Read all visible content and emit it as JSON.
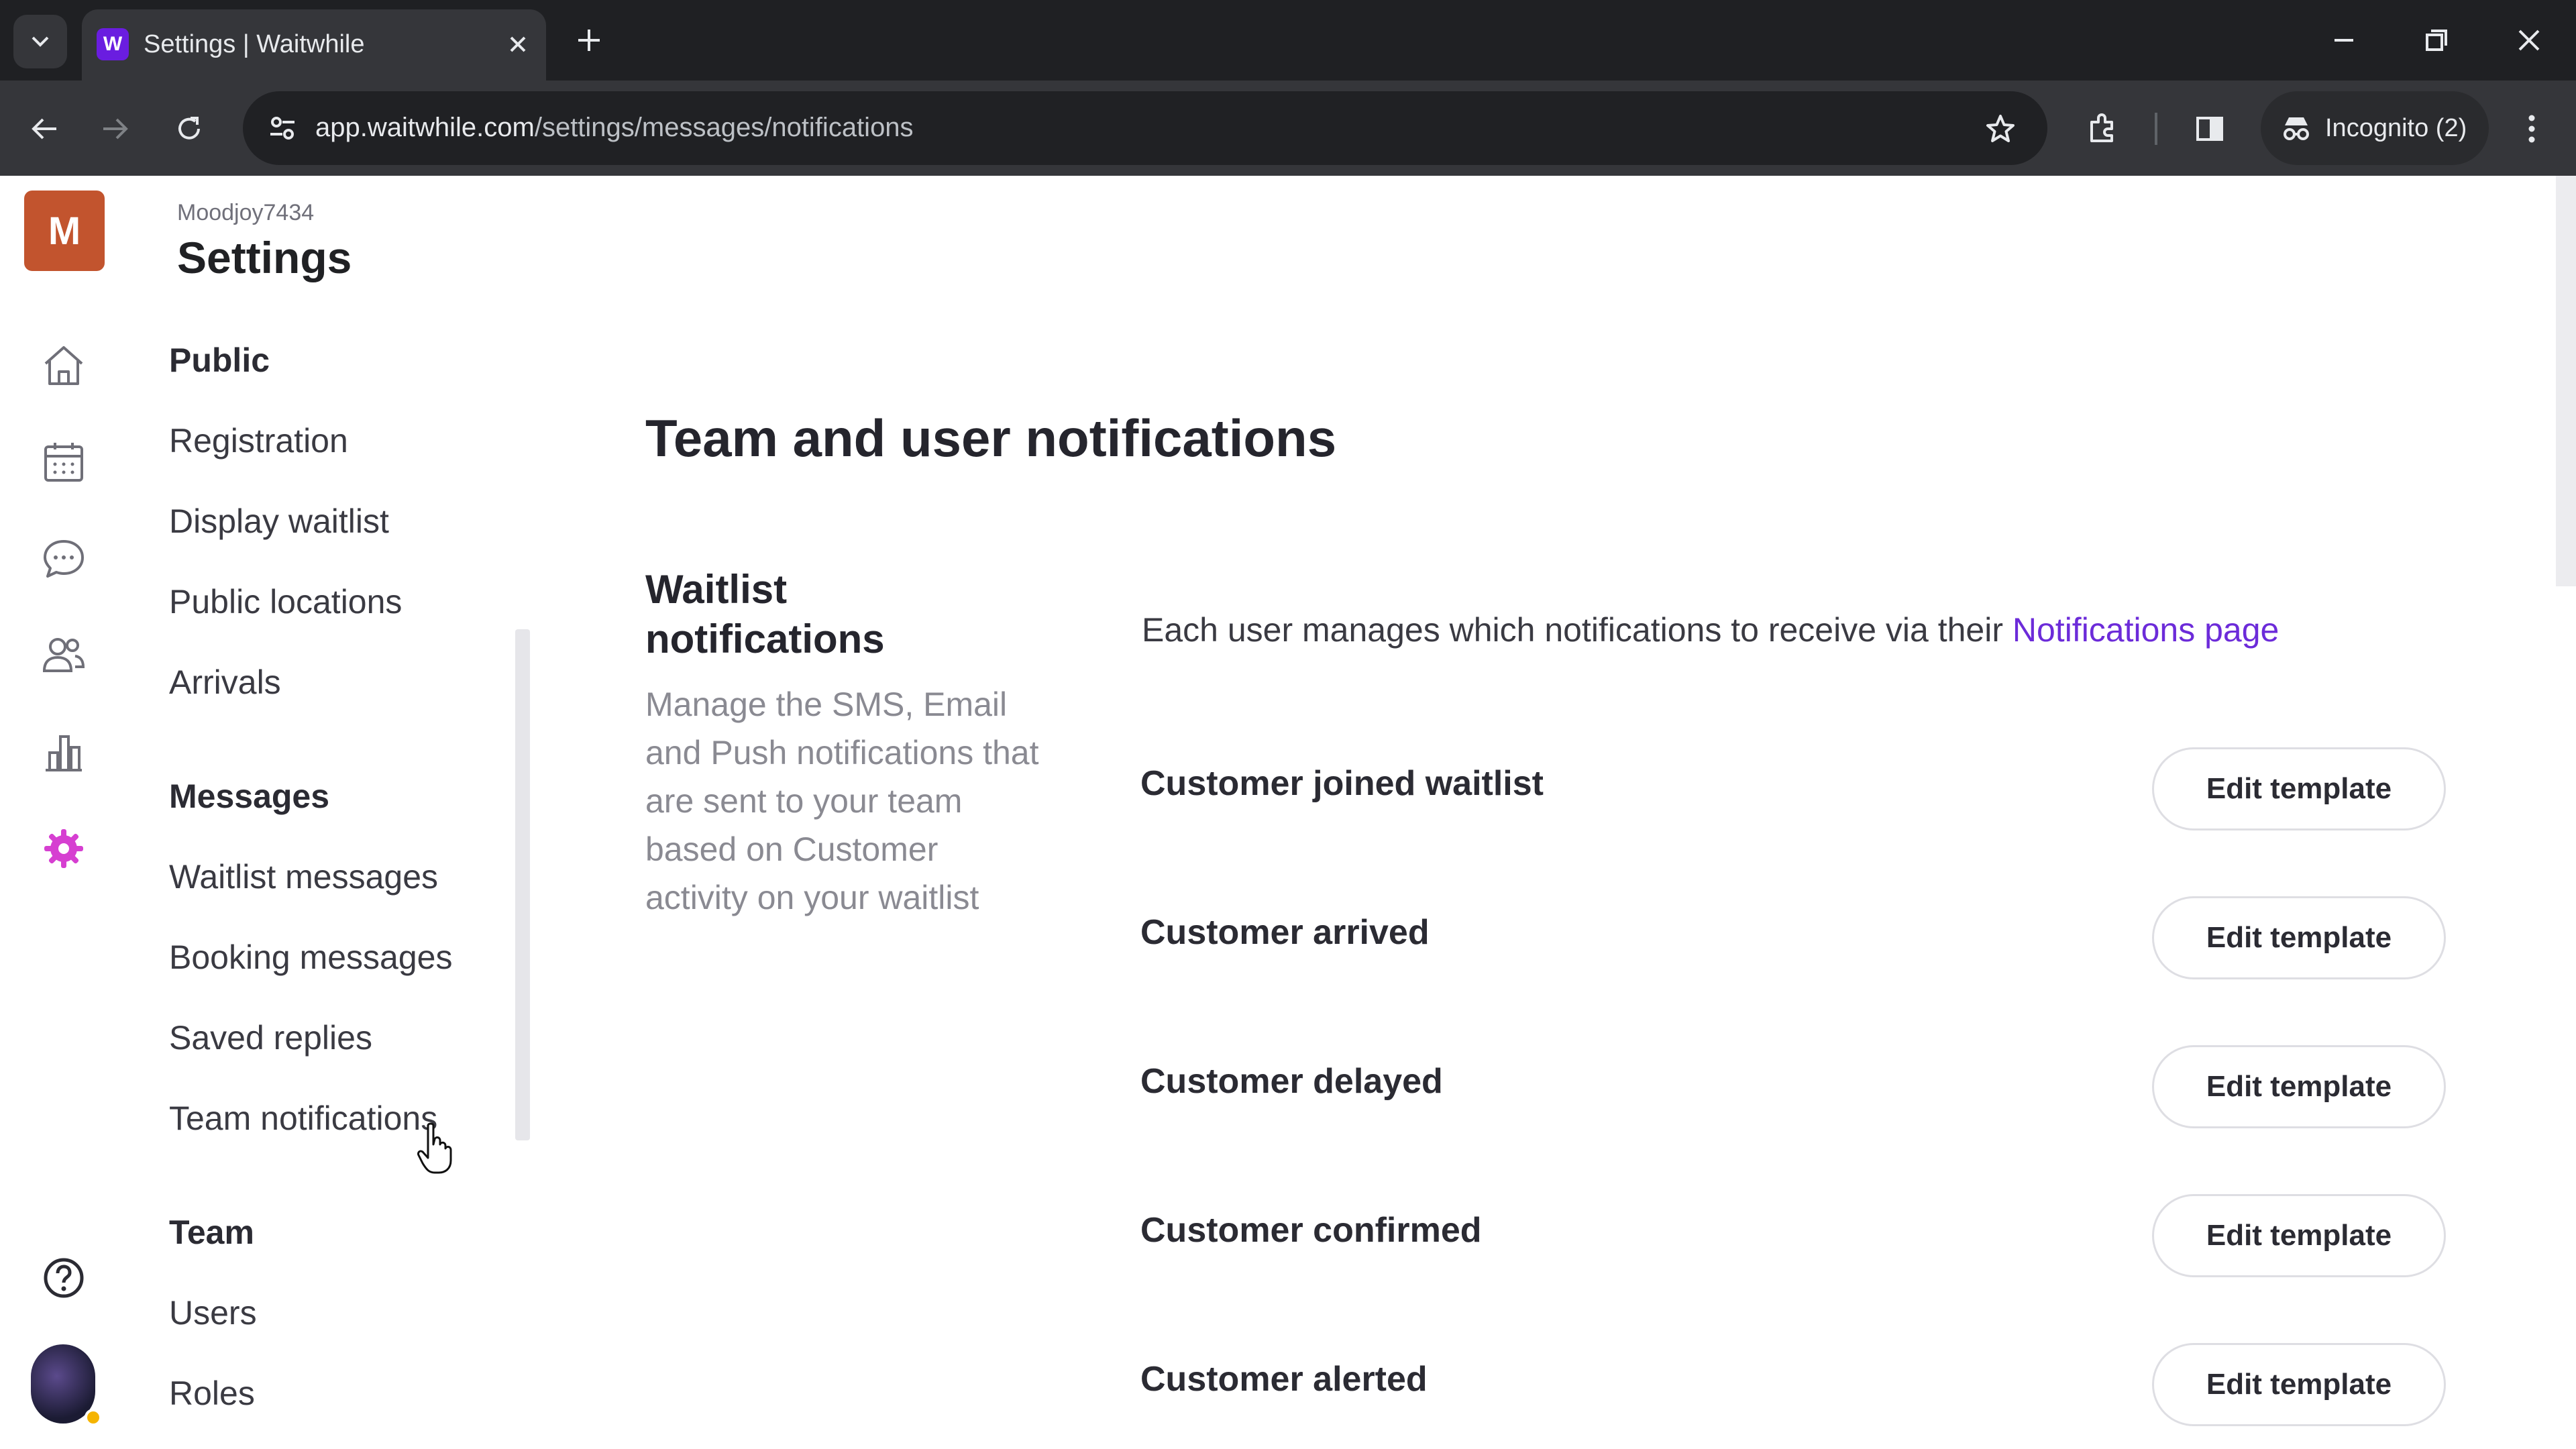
{
  "browser": {
    "tab_title": "Settings | Waitwhile",
    "favicon_letter": "W",
    "url_host": "app.waitwhile.com",
    "url_path": "/settings/messages/notifications",
    "incognito_label": "Incognito (2)"
  },
  "rail": {
    "workspace_initial": "M",
    "icons": [
      "home-icon",
      "calendar-icon",
      "chat-icon",
      "users-icon",
      "analytics-icon",
      "settings-icon",
      "help-icon"
    ]
  },
  "header": {
    "workspace_name": "Moodjoy7434",
    "title": "Settings"
  },
  "subnav": {
    "public_heading": "Public",
    "public_items": [
      "Registration",
      "Display waitlist",
      "Public locations",
      "Arrivals"
    ],
    "messages_heading": "Messages",
    "messages_items": [
      "Waitlist messages",
      "Booking messages",
      "Saved replies",
      "Team notifications"
    ],
    "team_heading": "Team",
    "team_items": [
      "Users",
      "Roles"
    ]
  },
  "main": {
    "page_title": "Team and user notifications",
    "section_title": "Waitlist notifications",
    "section_description": "Manage the SMS, Email and Push notifications that are sent to your team based on Customer activity on your waitlist",
    "info_text": "Each user manages which notifications to receive via their ",
    "info_link": "Notifications page",
    "rows": [
      {
        "label": "Customer joined waitlist",
        "button": "Edit template"
      },
      {
        "label": "Customer arrived",
        "button": "Edit template"
      },
      {
        "label": "Customer delayed",
        "button": "Edit template"
      },
      {
        "label": "Customer confirmed",
        "button": "Edit template"
      },
      {
        "label": "Customer alerted",
        "button": "Edit template"
      }
    ]
  },
  "colors": {
    "accent": "#6c2bd9",
    "workspace_avatar": "#c2542e",
    "active_settings_icon": "#d63fd1"
  }
}
